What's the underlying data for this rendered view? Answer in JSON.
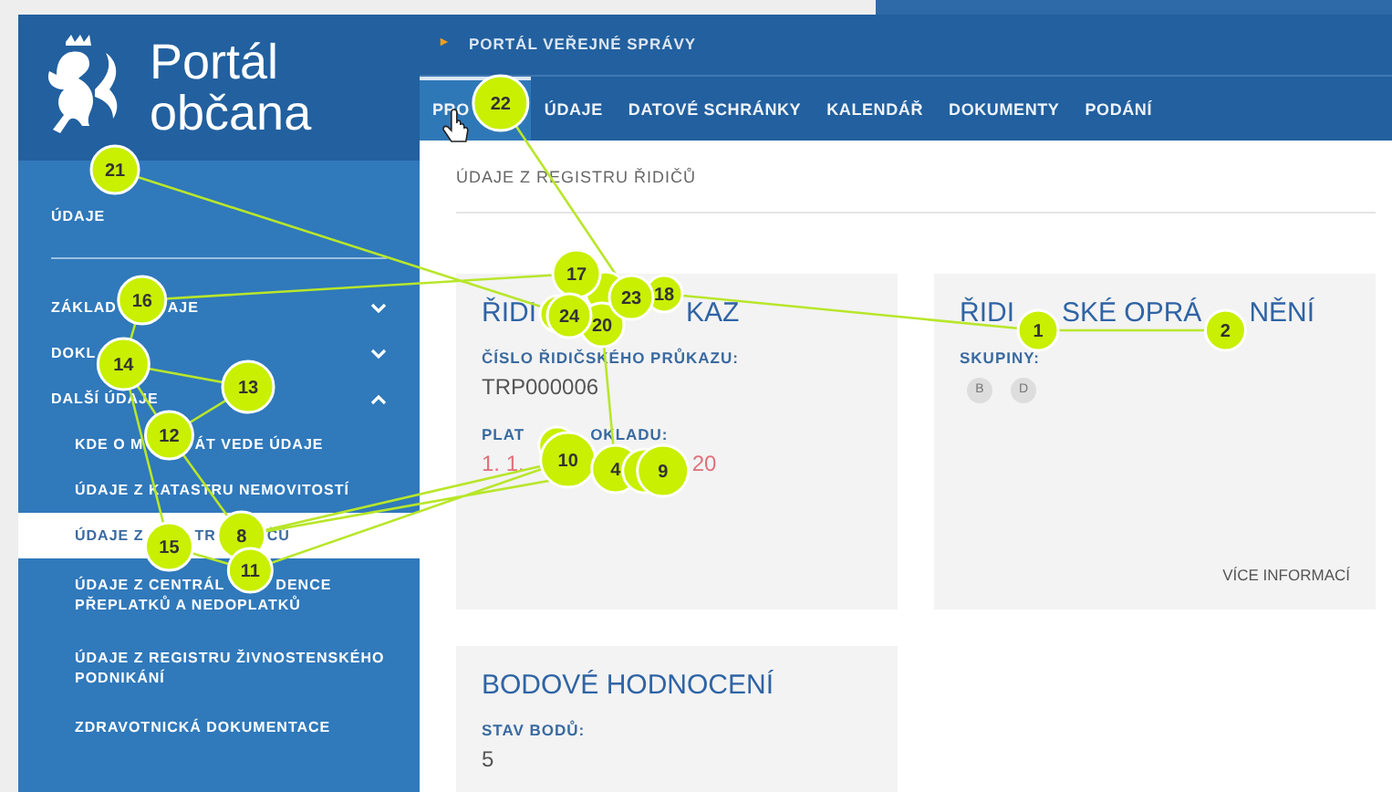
{
  "header": {
    "logo_text_line1": "Portál",
    "logo_text_line2": "občana",
    "breadcrumb_marker": "►",
    "breadcrumb": "PORTÁL VEŘEJNÉ SPRÁVY",
    "tabs": [
      {
        "label": "PRO",
        "selected": true
      },
      {
        "label": "ÚDAJE",
        "selected": false
      },
      {
        "label": "DATOVÉ SCHRÁNKY",
        "selected": false
      },
      {
        "label": "KALENDÁŘ",
        "selected": false
      },
      {
        "label": "DOKUMENTY",
        "selected": false
      },
      {
        "label": "PODÁNÍ",
        "selected": false
      }
    ]
  },
  "sidebar": {
    "title": "ÚDAJE",
    "items": [
      {
        "label_parts": [
          "ZÁKLAD",
          "AJE"
        ],
        "expanded": false
      },
      {
        "label_parts": [
          "DOKL"
        ],
        "expanded": false
      },
      {
        "label_parts": [
          "DALŠÍ ÚDAJE"
        ],
        "expanded": true,
        "children": [
          {
            "label_parts": [
              "KDE O M",
              "ÁT VEDE ÚDAJE"
            ],
            "selected": false
          },
          {
            "label_parts": [
              "ÚDAJE Z KATASTRU NEMOVITOSTÍ"
            ],
            "selected": false
          },
          {
            "label_parts": [
              "ÚDAJE Z",
              "TR",
              "ČŮ"
            ],
            "selected": true
          },
          {
            "label_parts": [
              "ÚDAJE Z CENTRÁL",
              "DENCE"
            ],
            "second_line": "PŘEPLATKŮ A NEDOPLATKŮ",
            "selected": false
          },
          {
            "label_parts": [
              "ÚDAJE Z REGISTRU ŽIVNOSTENSKÉHO"
            ],
            "second_line": "PODNIKÁNÍ",
            "selected": false
          },
          {
            "label_parts": [
              "ZDRAVOTNICKÁ DOKUMENTACE"
            ],
            "selected": false
          }
        ]
      }
    ]
  },
  "page_title": "ÚDAJE Z REGISTRU ŘIDIČŮ",
  "cards": [
    {
      "title_parts": [
        "ŘIDI",
        "KAZ"
      ],
      "fields": [
        {
          "label_parts": [
            "ČÍSLO ŘIDIČSKÉHO PRŮKAZU:"
          ],
          "value_parts": [
            "TRP000006"
          ],
          "alert": false
        },
        {
          "label_parts": [
            "PLAT",
            "OKLADU:"
          ],
          "value_parts": [
            "1. 1.",
            "20"
          ],
          "alert": true
        }
      ]
    },
    {
      "title_parts": [
        "ŘIDI",
        "SKÉ OPRÁ",
        "NĚNÍ"
      ],
      "groups_label": "SKUPINY:",
      "groups": [
        "B",
        "D"
      ],
      "link": "VÍCE INFORMACÍ"
    },
    {
      "title_parts": [
        "BODOVÉ HODNOCENÍ"
      ],
      "fields": [
        {
          "label_parts": [
            "STAV BODŮ:"
          ],
          "value_parts": [
            "5"
          ],
          "alert": false
        }
      ]
    }
  ],
  "gaze_points": [
    {
      "label": "1"
    },
    {
      "label": "2"
    },
    {
      "label": "4"
    },
    {
      "label": "8"
    },
    {
      "label": "9"
    },
    {
      "label": "10"
    },
    {
      "label": "11"
    },
    {
      "label": "12"
    },
    {
      "label": "13"
    },
    {
      "label": "14"
    },
    {
      "label": "15"
    },
    {
      "label": "16"
    },
    {
      "label": "17"
    },
    {
      "label": "18"
    },
    {
      "label": "20"
    },
    {
      "label": "21"
    },
    {
      "label": "22"
    },
    {
      "label": "23"
    },
    {
      "label": "24"
    }
  ]
}
